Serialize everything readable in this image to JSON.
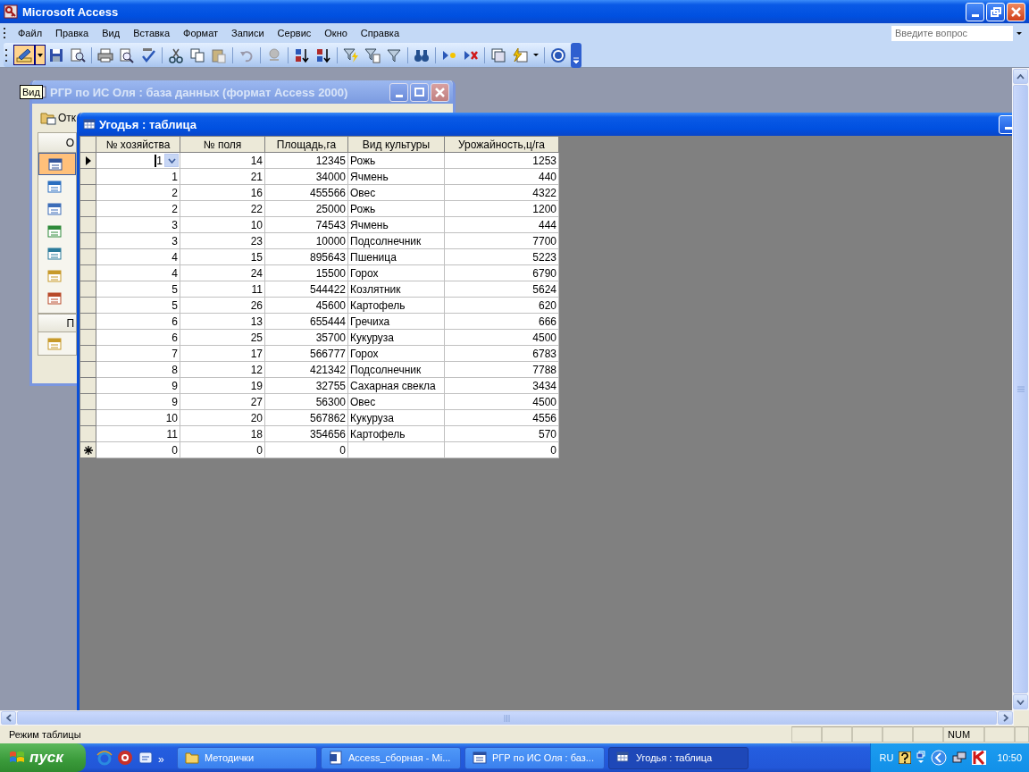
{
  "window": {
    "title": "Microsoft Access"
  },
  "menu": [
    "Файл",
    "Правка",
    "Вид",
    "Вставка",
    "Формат",
    "Записи",
    "Сервис",
    "Окно",
    "Справка"
  ],
  "help_box": {
    "placeholder": "Введите вопрос"
  },
  "tooltip": "Вид",
  "db_window": {
    "title": "РГР по ИС Оля : база данных (формат Access 2000)",
    "open_button": "Отк",
    "objects_header": "О",
    "groups_header": "П",
    "objects": [
      {
        "selected": true
      },
      {
        "selected": false
      },
      {
        "selected": false
      },
      {
        "selected": false
      },
      {
        "selected": false
      },
      {
        "selected": false
      },
      {
        "selected": false
      }
    ],
    "groups": [
      {
        "selected": false
      }
    ]
  },
  "table_window": {
    "title": "Угодья : таблица",
    "columns": [
      {
        "label": "№ хозяйства",
        "kind": "number"
      },
      {
        "label": "№ поля",
        "kind": "number"
      },
      {
        "label": "Площадь,га",
        "kind": "number"
      },
      {
        "label": "Вид культуры",
        "kind": "text"
      },
      {
        "label": "Урожайность,ц/га",
        "kind": "number"
      }
    ],
    "rows": [
      {
        "kind": "record",
        "selected": true,
        "cells": [
          "1",
          "14",
          "12345",
          "Рожь",
          "1253"
        ]
      },
      {
        "kind": "record",
        "selected": false,
        "cells": [
          "1",
          "21",
          "34000",
          "Ячмень",
          "440"
        ]
      },
      {
        "kind": "record",
        "selected": false,
        "cells": [
          "2",
          "16",
          "455566",
          "Овес",
          "4322"
        ]
      },
      {
        "kind": "record",
        "selected": false,
        "cells": [
          "2",
          "22",
          "25000",
          "Рожь",
          "1200"
        ]
      },
      {
        "kind": "record",
        "selected": false,
        "cells": [
          "3",
          "10",
          "74543",
          "Ячмень",
          "444"
        ]
      },
      {
        "kind": "record",
        "selected": false,
        "cells": [
          "3",
          "23",
          "10000",
          "Подсолнечник",
          "7700"
        ]
      },
      {
        "kind": "record",
        "selected": false,
        "cells": [
          "4",
          "15",
          "895643",
          "Пшеница",
          "5223"
        ]
      },
      {
        "kind": "record",
        "selected": false,
        "cells": [
          "4",
          "24",
          "15500",
          "Горох",
          "6790"
        ]
      },
      {
        "kind": "record",
        "selected": false,
        "cells": [
          "5",
          "11",
          "544422",
          "Козлятник",
          "5624"
        ]
      },
      {
        "kind": "record",
        "selected": false,
        "cells": [
          "5",
          "26",
          "45600",
          "Картофель",
          "620"
        ]
      },
      {
        "kind": "record",
        "selected": false,
        "cells": [
          "6",
          "13",
          "655444",
          "Гречиха",
          "666"
        ]
      },
      {
        "kind": "record",
        "selected": false,
        "cells": [
          "6",
          "25",
          "35700",
          "Кукуруза",
          "4500"
        ]
      },
      {
        "kind": "record",
        "selected": false,
        "cells": [
          "7",
          "17",
          "566777",
          "Горох",
          "6783"
        ]
      },
      {
        "kind": "record",
        "selected": false,
        "cells": [
          "8",
          "12",
          "421342",
          "Подсолнечник",
          "7788"
        ]
      },
      {
        "kind": "record",
        "selected": false,
        "cells": [
          "9",
          "19",
          "32755",
          "Сахарная свекла",
          "3434"
        ]
      },
      {
        "kind": "record",
        "selected": false,
        "cells": [
          "9",
          "27",
          "56300",
          "Овес",
          "4500"
        ]
      },
      {
        "kind": "record",
        "selected": false,
        "cells": [
          "10",
          "20",
          "567862",
          "Кукуруза",
          "4556"
        ]
      },
      {
        "kind": "record",
        "selected": false,
        "cells": [
          "11",
          "18",
          "354656",
          "Картофель",
          "570"
        ]
      },
      {
        "kind": "new",
        "selected": false,
        "cells": [
          "0",
          "0",
          "0",
          "",
          "0"
        ]
      }
    ]
  },
  "status_bar": {
    "text": "Режим таблицы",
    "indicator": "NUM"
  },
  "taskbar": {
    "start": "пуск",
    "more": "»",
    "buttons": [
      {
        "label": "Методички",
        "kind": "folder",
        "selected": false
      },
      {
        "label": "Access_сборная - Mi...",
        "kind": "word",
        "selected": false
      },
      {
        "label": "РГР по ИС Оля : баз...",
        "kind": "database",
        "selected": false
      },
      {
        "label": "Угодья : таблица",
        "kind": "table",
        "selected": true
      }
    ],
    "language": "RU",
    "clock": "10:50"
  }
}
